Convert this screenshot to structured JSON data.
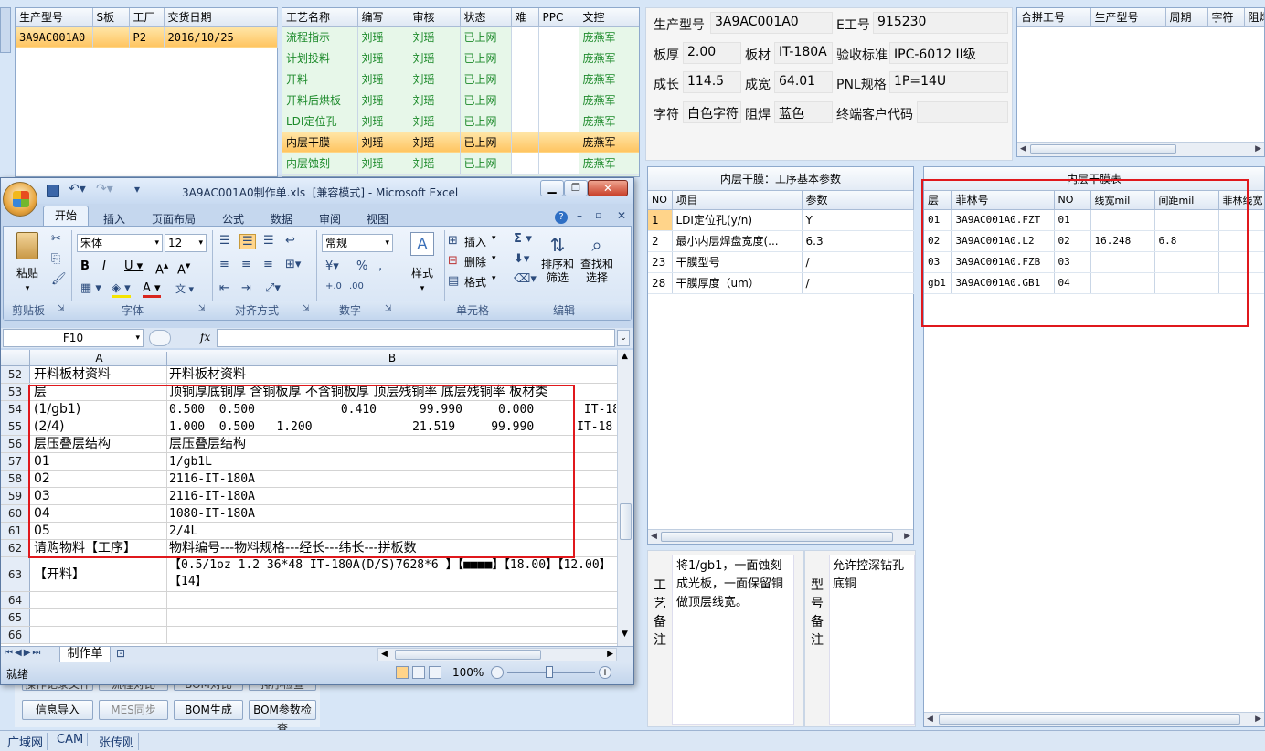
{
  "left_order_grid": {
    "headers": [
      "生产型号",
      "S板",
      "工厂",
      "交货日期"
    ],
    "rows": [
      [
        "3A9AC001A0",
        "",
        "P2",
        "2016/10/25"
      ]
    ]
  },
  "process_grid": {
    "headers": [
      "工艺名称",
      "编写",
      "审核",
      "状态",
      "难",
      "PPC",
      "文控"
    ],
    "rows": [
      [
        "流程指示",
        "刘瑶",
        "刘瑶",
        "已上网",
        "",
        "",
        "庞燕军"
      ],
      [
        "计划投料",
        "刘瑶",
        "刘瑶",
        "已上网",
        "",
        "",
        "庞燕军"
      ],
      [
        "开料",
        "刘瑶",
        "刘瑶",
        "已上网",
        "",
        "",
        "庞燕军"
      ],
      [
        "开料后烘板",
        "刘瑶",
        "刘瑶",
        "已上网",
        "",
        "",
        "庞燕军"
      ],
      [
        "LDI定位孔",
        "刘瑶",
        "刘瑶",
        "已上网",
        "",
        "",
        "庞燕军"
      ],
      [
        "内层干膜",
        "刘瑶",
        "刘瑶",
        "已上网",
        "",
        "",
        "庞燕军"
      ],
      [
        "内层蚀刻",
        "刘瑶",
        "刘瑶",
        "已上网",
        "",
        "",
        "庞燕军"
      ]
    ]
  },
  "info": {
    "prod_model_label": "生产型号",
    "prod_model": "3A9AC001A0",
    "e_no_label": "E工号",
    "e_no": "915230",
    "thickness_label": "板厚",
    "thickness": "2.00",
    "material_label": "板材",
    "material": "IT-180A",
    "accept_label": "验收标准",
    "accept": "IPC-6012 II级",
    "length_label": "成长",
    "length": "114.5",
    "width_label": "成宽",
    "width": "64.01",
    "pnl_label": "PNL规格",
    "pnl": "1P=14U",
    "char_label": "字符",
    "char": "白色字符",
    "mask_label": "阻焊",
    "mask": "蓝色",
    "customer_label": "终端客户代码",
    "customer": ""
  },
  "merge_grid": {
    "headers": [
      "合拼工号",
      "生产型号",
      "周期",
      "字符",
      "阻焊"
    ]
  },
  "params_panel": {
    "title": "内层干膜：工序基本参数",
    "headers": [
      "NO",
      "项目",
      "参数"
    ],
    "rows": [
      [
        "1",
        "LDI定位孔(y/n)",
        "Y"
      ],
      [
        "2",
        "最小内层焊盘宽度(...",
        "6.3"
      ],
      [
        "23",
        "干膜型号",
        "/"
      ],
      [
        "28",
        "干膜厚度（um）",
        "/"
      ]
    ]
  },
  "film_panel": {
    "title": "内层干膜表",
    "headers": [
      "层",
      "菲林号",
      "NO",
      "线宽mil",
      "间距mil",
      "菲林线宽"
    ],
    "rows": [
      [
        "01",
        "3A9AC001A0.FZT",
        "01",
        "",
        "",
        ""
      ],
      [
        "02",
        "3A9AC001A0.L2",
        "02",
        "16.248",
        "6.8",
        ""
      ],
      [
        "03",
        "3A9AC001A0.FZB",
        "03",
        "",
        "",
        ""
      ],
      [
        "gb1",
        "3A9AC001A0.GB1",
        "04",
        "",
        "",
        ""
      ]
    ]
  },
  "notes": {
    "process_label": "工艺备注",
    "process_text": "将1/gb1，一面蚀刻成光板，一面保留铜做顶层线宽。",
    "model_label": "型号备注",
    "model_text": "允许控深钻孔底铜"
  },
  "bottom_buttons": [
    "信息导入",
    "MES同步",
    "BOM生成",
    "BOM参数检查"
  ],
  "hidden_buttons": [
    "操作记录文件",
    "流程对比",
    "BOM对比",
    "排序检查"
  ],
  "status_bar": [
    "广域网",
    "CAM",
    "张传刚"
  ],
  "excel": {
    "title": "3A9AC001A0制作单.xls  [兼容模式] - Microsoft Excel",
    "office_button": "Office",
    "tabs": [
      "开始",
      "插入",
      "页面布局",
      "公式",
      "数据",
      "审阅",
      "视图"
    ],
    "font_name": "宋体",
    "font_size": "12",
    "number_format": "常规",
    "ribbon": {
      "paste": "粘贴",
      "styles": "样式",
      "insert": "插入",
      "delete": "删除",
      "format": "格式",
      "sort": "排序和\n筛选",
      "find": "查找和\n选择"
    },
    "groups": [
      "剪贴板",
      "字体",
      "对齐方式",
      "数字",
      "单元格",
      "编辑"
    ],
    "name_box": "F10",
    "fx": "fx",
    "col_headers": [
      "A",
      "B"
    ],
    "rows": [
      {
        "n": "52",
        "a": "开料板材资料",
        "b": "开料板材资料"
      },
      {
        "n": "53",
        "a": "层",
        "b": "顶铜厚底铜厚 含铜板厚 不含铜板厚 顶层残铜率 底层残铜率 板材类"
      },
      {
        "n": "54",
        "a": "(1/gb1)",
        "b": "0.500  0.500            0.410      99.990     0.000       IT-18"
      },
      {
        "n": "55",
        "a": "(2/4)",
        "b": "1.000  0.500   1.200              21.519     99.990      IT-18"
      },
      {
        "n": "56",
        "a": "层压叠层结构",
        "b": "层压叠层结构"
      },
      {
        "n": "57",
        "a": "01",
        "b": "1/gb1L"
      },
      {
        "n": "58",
        "a": "02",
        "b": "2116-IT-180A"
      },
      {
        "n": "59",
        "a": "03",
        "b": "2116-IT-180A"
      },
      {
        "n": "60",
        "a": "04",
        "b": "1080-IT-180A"
      },
      {
        "n": "61",
        "a": "05",
        "b": "2/4L"
      },
      {
        "n": "62",
        "a": "请购物料【工序】",
        "b": "物料编号---物料规格---经长---纬长---拼板数"
      },
      {
        "n": "63",
        "a": "【开料】",
        "b": "【0.5/1oz 1.2 36*48 IT-180A(D/S)7628*6 】【■■■■】【18.00】【12.00】【14】"
      },
      {
        "n": "64",
        "a": "",
        "b": ""
      },
      {
        "n": "65",
        "a": "",
        "b": ""
      },
      {
        "n": "66",
        "a": "",
        "b": ""
      }
    ],
    "sheet_tab": "制作单",
    "status": "就绪",
    "zoom": "100%"
  }
}
